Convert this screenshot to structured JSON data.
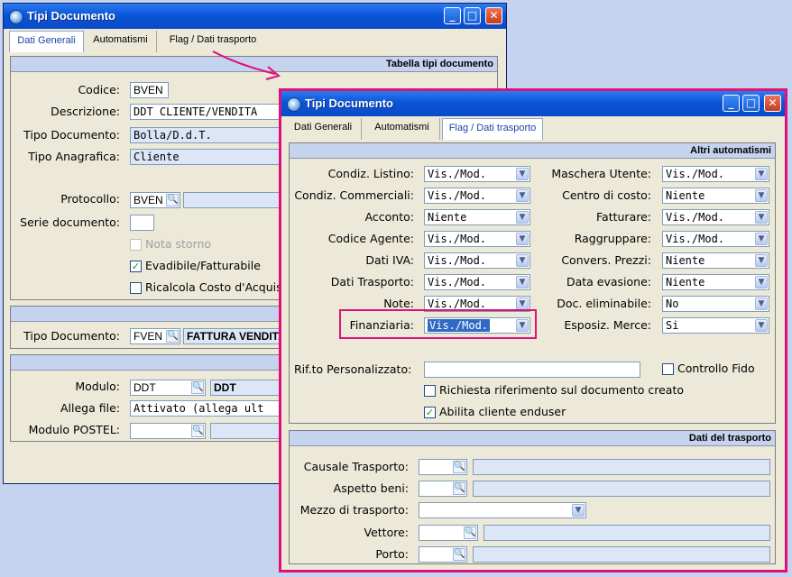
{
  "back_window": {
    "title": "Tipi Documento",
    "tabs": [
      "Dati Generali",
      "Automatismi",
      "Flag / Dati trasporto"
    ],
    "band1": "Tabella tipi documento",
    "codice_label": "Codice:",
    "codice": "BVEN",
    "descrizione_label": "Descrizione:",
    "descrizione": "DDT CLIENTE/VENDITA",
    "tipo_documento_label": "Tipo Documento:",
    "tipo_documento": "Bolla/D.d.T.",
    "tipo_anagrafica_label": "Tipo Anagrafica:",
    "tipo_anagrafica": "Cliente",
    "protocollo_label": "Protocollo:",
    "protocollo": "BVEN",
    "serie_label": "Serie documento:",
    "nota_storno": "Nota storno",
    "evadibile": "Evadibile/Fatturabile",
    "ricalcola": "Ricalcola Costo d'Acquis",
    "tipo_documento2_label": "Tipo Documento:",
    "tipo_documento2": "FVEN",
    "tipo_documento2_desc": "FATTURA VENDITA",
    "modulo_label": "Modulo:",
    "modulo": "DDT",
    "modulo_desc": "DDT",
    "allega_label": "Allega file:",
    "allega": "Attivato (allega ult",
    "postel_label": "Modulo POSTEL:"
  },
  "front_window": {
    "title": "Tipi Documento",
    "tabs": [
      "Dati Generali",
      "Automatismi",
      "Flag / Dati trasporto"
    ],
    "band_altri": "Altri automatismi",
    "left_fields": [
      {
        "label": "Condiz. Listino:",
        "value": "Vis./Mod."
      },
      {
        "label": "Condiz. Commerciali:",
        "value": "Vis./Mod."
      },
      {
        "label": "Acconto:",
        "value": "Niente"
      },
      {
        "label": "Codice Agente:",
        "value": "Vis./Mod."
      },
      {
        "label": "Dati IVA:",
        "value": "Vis./Mod."
      },
      {
        "label": "Dati Trasporto:",
        "value": "Vis./Mod."
      },
      {
        "label": "Note:",
        "value": "Vis./Mod."
      },
      {
        "label": "Finanziaria:",
        "value": "Vis./Mod."
      }
    ],
    "right_fields": [
      {
        "label": "Maschera Utente:",
        "value": "Vis./Mod."
      },
      {
        "label": "Centro di costo:",
        "value": "Niente"
      },
      {
        "label": "Fatturare:",
        "value": "Vis./Mod."
      },
      {
        "label": "Raggruppare:",
        "value": "Vis./Mod."
      },
      {
        "label": "Convers. Prezzi:",
        "value": "Niente"
      },
      {
        "label": "Data evasione:",
        "value": "Niente"
      },
      {
        "label": "Doc. eliminabile:",
        "value": "No"
      },
      {
        "label": "Esposiz. Merce:",
        "value": "Si"
      }
    ],
    "rif_label": "Rif.to Personalizzato:",
    "rif_value": "",
    "controllo_fido": "Controllo Fido",
    "richiesta_rif": "Richiesta riferimento sul documento creato",
    "abilita_enduser": "Abilita cliente enduser",
    "band_trasporto": "Dati del trasporto",
    "causale_label": "Causale Trasporto:",
    "aspetto_label": "Aspetto beni:",
    "mezzo_label": "Mezzo di trasporto:",
    "vettore_label": "Vettore:",
    "porto_label": "Porto:"
  },
  "colors": {
    "annotation": "#e0107a",
    "titlebar": "#0a55d8",
    "band": "#c5d3ee"
  }
}
